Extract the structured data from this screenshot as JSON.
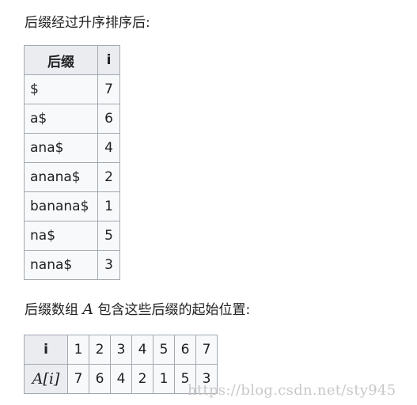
{
  "intro_text": "后缀经过升序排序后:",
  "suffix_table": {
    "headers": [
      "后缀",
      "i"
    ],
    "rows": [
      {
        "suffix": "$",
        "i": "7"
      },
      {
        "suffix": "a$",
        "i": "6"
      },
      {
        "suffix": "ana$",
        "i": "4"
      },
      {
        "suffix": "anana$",
        "i": "2"
      },
      {
        "suffix": "banana$",
        "i": "1"
      },
      {
        "suffix": "na$",
        "i": "5"
      },
      {
        "suffix": "nana$",
        "i": "3"
      }
    ]
  },
  "array_text": {
    "before": "后缀数组 ",
    "math": "A",
    "after": " 包含这些后缀的起始位置:"
  },
  "array_table": {
    "row_headers": [
      "i",
      "A[i]"
    ],
    "index_row": [
      "1",
      "2",
      "3",
      "4",
      "5",
      "6",
      "7"
    ],
    "value_row": [
      "7",
      "6",
      "4",
      "2",
      "1",
      "5",
      "3"
    ]
  },
  "watermark": "https://blog.csdn.net/sty945"
}
